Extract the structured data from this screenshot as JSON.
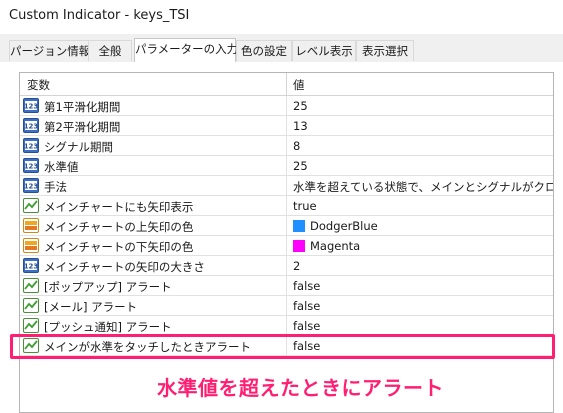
{
  "window": {
    "title": "Custom Indicator - keys_TSI"
  },
  "tabs": [
    {
      "label": "パージョン情報"
    },
    {
      "label": "全般"
    },
    {
      "label": "パラメーターの入力"
    },
    {
      "label": "色の設定"
    },
    {
      "label": "レベル表示"
    },
    {
      "label": "表示選択"
    }
  ],
  "grid": {
    "headers": {
      "variable": "変数",
      "value": "値"
    },
    "rows": [
      {
        "name": "第1平滑化期間",
        "value": "25",
        "icon": "number-param-icon"
      },
      {
        "name": "第2平滑化期間",
        "value": "13",
        "icon": "number-param-icon"
      },
      {
        "name": "シグナル期間",
        "value": "8",
        "icon": "number-param-icon"
      },
      {
        "name": "水準値",
        "value": "25",
        "icon": "number-param-icon"
      },
      {
        "name": "手法",
        "value": "水準を超えている状態で、メインとシグナルがクロス",
        "icon": "number-param-icon"
      },
      {
        "name": "メインチャートにも矢印表示",
        "value": "true",
        "icon": "bool-param-icon"
      },
      {
        "name": "メインチャートの上矢印の色",
        "value": "DodgerBlue",
        "icon": "color-param-icon",
        "swatch": "#1e90ff"
      },
      {
        "name": "メインチャートの下矢印の色",
        "value": "Magenta",
        "icon": "color-param-icon",
        "swatch": "#ff00ff"
      },
      {
        "name": "メインチャートの矢印の大きさ",
        "value": "2",
        "icon": "number-param-icon"
      },
      {
        "name": "[ポップアップ] アラート",
        "value": "false",
        "icon": "bool-param-icon"
      },
      {
        "name": "[メール] アラート",
        "value": "false",
        "icon": "bool-param-icon"
      },
      {
        "name": "[プッシュ通知] アラート",
        "value": "false",
        "icon": "bool-param-icon"
      },
      {
        "name": "メインが水準をタッチしたときアラート",
        "value": "false",
        "icon": "bool-param-icon"
      }
    ]
  },
  "annotation": {
    "text": "水準値を超えたときにアラート",
    "color": "#ff1e72"
  }
}
